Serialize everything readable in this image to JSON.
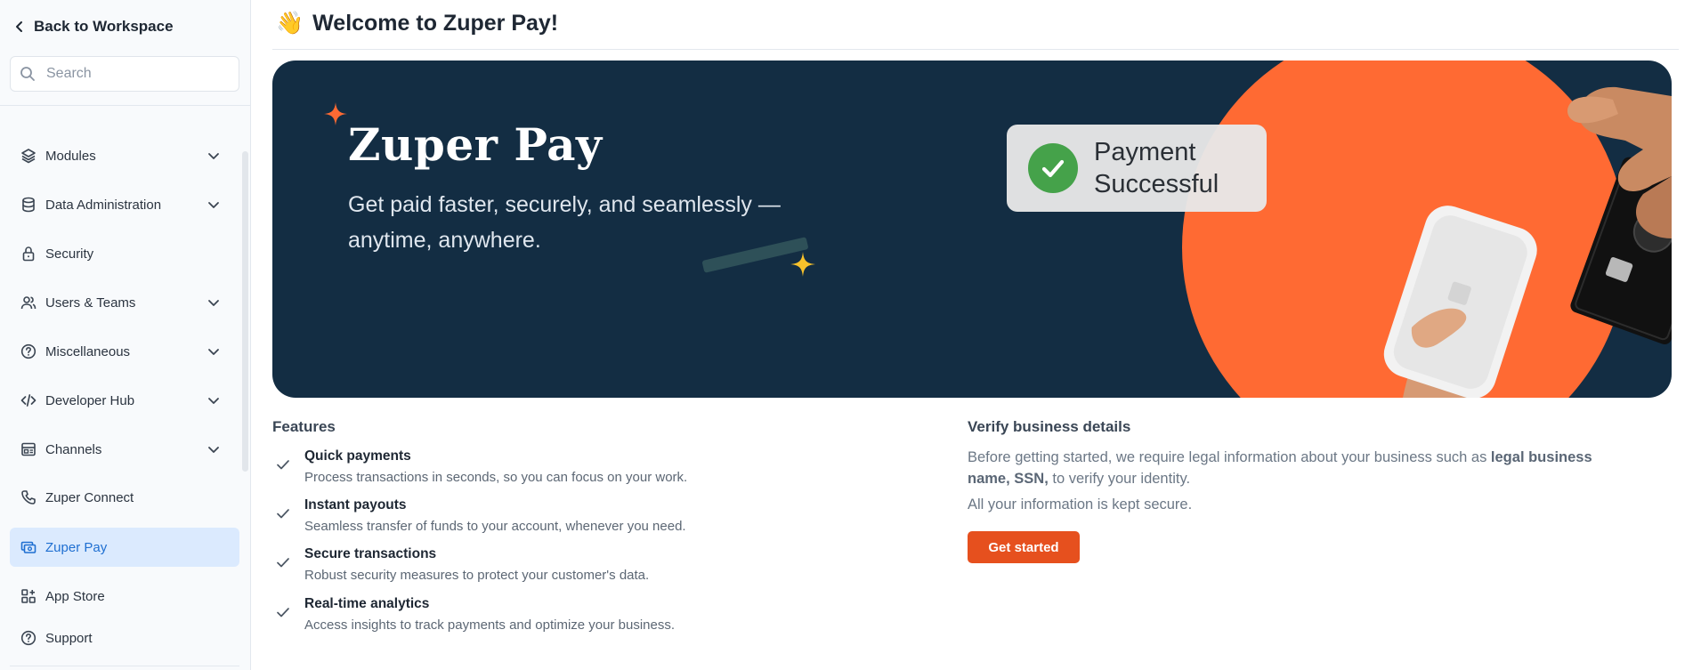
{
  "sidebar": {
    "back_label": "Back to Workspace",
    "search_placeholder": "Search",
    "items": [
      {
        "label": "Modules",
        "icon": "layers-icon",
        "has_chevron": true
      },
      {
        "label": "Data Administration",
        "icon": "database-icon",
        "has_chevron": true
      },
      {
        "label": "Security",
        "icon": "lock-icon",
        "has_chevron": false
      },
      {
        "label": "Users & Teams",
        "icon": "users-icon",
        "has_chevron": true
      },
      {
        "label": "Miscellaneous",
        "icon": "help-circle-icon",
        "has_chevron": true
      },
      {
        "label": "Developer Hub",
        "icon": "code-icon",
        "has_chevron": true
      },
      {
        "label": "Channels",
        "icon": "channels-icon",
        "has_chevron": true
      },
      {
        "label": "Zuper Connect",
        "icon": "phone-icon",
        "has_chevron": false
      },
      {
        "label": "Zuper Pay",
        "icon": "pay-icon",
        "has_chevron": false,
        "active": true
      },
      {
        "label": "App Store",
        "icon": "apps-icon",
        "has_chevron": false
      },
      {
        "label": "Support",
        "icon": "help-circle-icon",
        "has_chevron": false
      }
    ]
  },
  "header": {
    "emoji": "👋",
    "title": "Welcome to Zuper Pay!"
  },
  "banner": {
    "title": "Zuper Pay",
    "subtitle": "Get paid faster, securely, and seamlessly —anytime, anywhere.",
    "payment_line1": "Payment",
    "payment_line2": "Successful"
  },
  "features": {
    "title": "Features",
    "items": [
      {
        "title": "Quick payments",
        "desc": "Process transactions in seconds, so you can focus on your work."
      },
      {
        "title": "Instant payouts",
        "desc": "Seamless transfer of funds to your account, whenever you need."
      },
      {
        "title": "Secure transactions",
        "desc": "Robust security measures to protect your customer's data."
      },
      {
        "title": "Real-time analytics",
        "desc": "Access insights to track payments and optimize your business."
      }
    ]
  },
  "verify": {
    "title": "Verify business details",
    "text_before": "Before getting started, we require legal information about your business such as ",
    "text_bold": "legal business name, SSN,",
    "text_after": " to verify your identity.",
    "secure": "All your information is kept secure.",
    "button": "Get started"
  },
  "colors": {
    "accent": "#1f6fd1",
    "active_bg": "#dbeafe",
    "banner_bg": "#132d43",
    "banner_orange": "#ff6a33",
    "cta": "#e6501e"
  }
}
